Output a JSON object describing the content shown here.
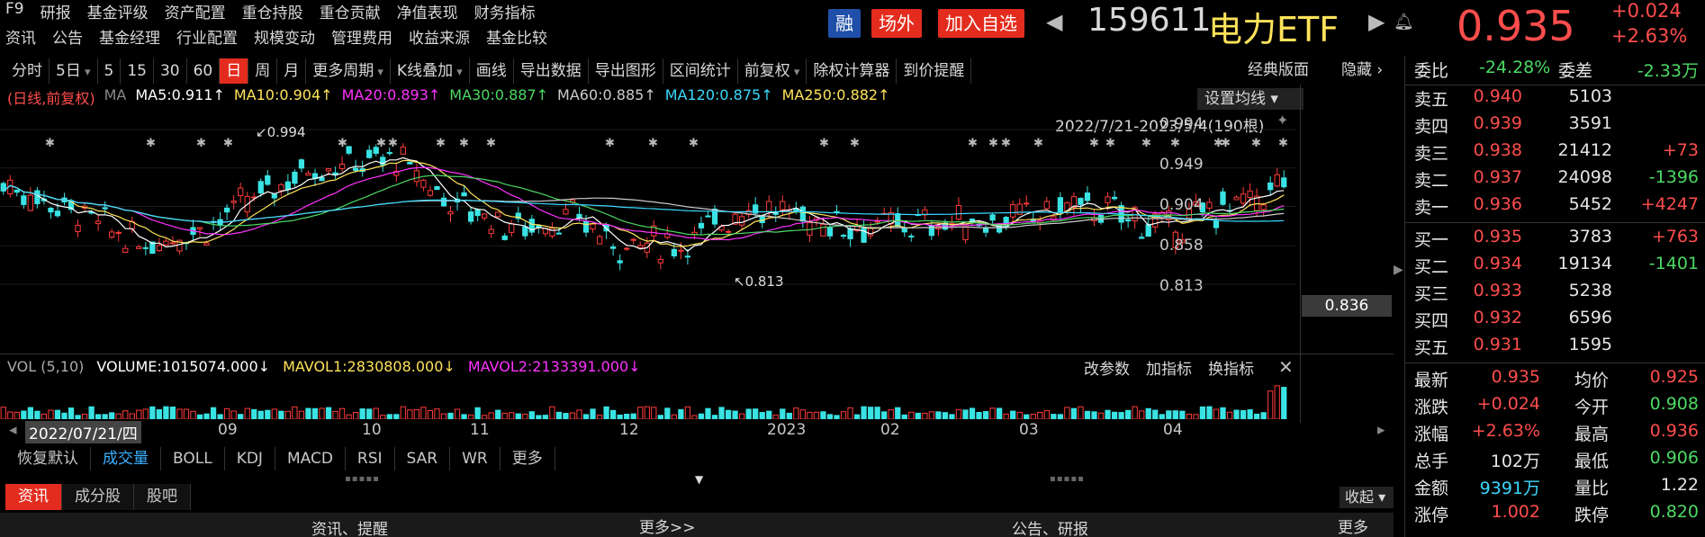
{
  "nav": {
    "row1": [
      "F9",
      "研报",
      "基金评级",
      "资产配置",
      "重仓持股",
      "重仓贡献",
      "净值表现",
      "财务指标"
    ],
    "row2": [
      "资讯",
      "公告",
      "基金经理",
      "行业配置",
      "规模变动",
      "管理费用",
      "收益来源",
      "基金比较"
    ]
  },
  "header": {
    "rong": "融",
    "changwai": "场外",
    "add_fav": "加入自选",
    "code": "159611",
    "name": "电力ETF",
    "price": "0.935",
    "change": "+0.024",
    "change_pct": "+2.63%"
  },
  "toolbar": {
    "items": [
      "分时",
      "5日",
      "5",
      "15",
      "30",
      "60",
      "日",
      "周",
      "月",
      "更多周期",
      "K线叠加",
      "画线",
      "导出数据",
      "导出图形",
      "区间统计",
      "前复权",
      "除权计算器",
      "到价提醒"
    ],
    "active": "日",
    "classic": "经典版面",
    "hide": "隐藏"
  },
  "ma": {
    "mode": "(日线,前复权)",
    "ma_label": "MA",
    "ma5": "MA5:0.911↑",
    "ma10": "MA10:0.904↑",
    "ma20": "MA20:0.893↑",
    "ma30": "MA30:0.887↑",
    "ma60": "MA60:0.885↑",
    "ma120": "MA120:0.875↑",
    "ma250": "MA250:0.882↑",
    "set_ma": "设置均线",
    "range": "2022/7/21-2023/5/4(190根)",
    "high_label": "0.994",
    "low_label": "0.813"
  },
  "colors": {
    "ma5": "#ffffff",
    "ma10": "#ffe35a",
    "ma20": "#ff33ff",
    "ma30": "#4cd964",
    "ma60": "#cccccc",
    "ma120": "#3ad9ff",
    "ma250": "#ffe35a",
    "up": "#ff3b3b",
    "down": "#3ae3e3"
  },
  "yaxis": [
    "0.994",
    "0.949",
    "0.904",
    "0.858",
    "0.813"
  ],
  "price_tag": "0.836",
  "vol": {
    "label": "VOL (5,10)",
    "volume": "VOLUME:1015074.000↓",
    "mavol1": "MAVOL1:2830808.000↓",
    "mavol2": "MAVOL2:2133391.000↓",
    "btns": [
      "改参数",
      "加指标",
      "换指标"
    ]
  },
  "dates": {
    "cursor": "2022/07/21/四",
    "ticks": [
      "09",
      "10",
      "11",
      "12",
      "2023",
      "02",
      "03",
      "04"
    ]
  },
  "ind_tabs": [
    "恢复默认",
    "成交量",
    "BOLL",
    "KDJ",
    "MACD",
    "RSI",
    "SAR",
    "WR",
    "更多"
  ],
  "ind_active": "成交量",
  "bottom_tabs": [
    "资讯",
    "成分股",
    "股吧"
  ],
  "bottom_active": "资讯",
  "collapse": "收起",
  "news": {
    "left": "资讯、提醒",
    "left_more": "更多>>",
    "right": "公告、研报",
    "right_more": "更多>>"
  },
  "panel": {
    "weibi_label": "委比",
    "weibi": "-24.28%",
    "weicha_label": "委差",
    "weicha": "-2.33万",
    "asks": [
      {
        "label": "卖五",
        "price": "0.940",
        "vol": "5103",
        "chg": ""
      },
      {
        "label": "卖四",
        "price": "0.939",
        "vol": "3591",
        "chg": ""
      },
      {
        "label": "卖三",
        "price": "0.938",
        "vol": "21412",
        "chg": "+73"
      },
      {
        "label": "卖二",
        "price": "0.937",
        "vol": "24098",
        "chg": "-1396"
      },
      {
        "label": "卖一",
        "price": "0.936",
        "vol": "5452",
        "chg": "+4247"
      }
    ],
    "bids": [
      {
        "label": "买一",
        "price": "0.935",
        "vol": "3783",
        "chg": "+763"
      },
      {
        "label": "买二",
        "price": "0.934",
        "vol": "19134",
        "chg": "-1401"
      },
      {
        "label": "买三",
        "price": "0.933",
        "vol": "5238",
        "chg": ""
      },
      {
        "label": "买四",
        "price": "0.932",
        "vol": "6596",
        "chg": ""
      },
      {
        "label": "买五",
        "price": "0.931",
        "vol": "1595",
        "chg": ""
      }
    ],
    "stats": [
      {
        "l1": "最新",
        "v1": "0.935",
        "l2": "均价",
        "v2": "0.925"
      },
      {
        "l1": "涨跌",
        "v1": "+0.024",
        "l2": "今开",
        "v2": "0.908"
      },
      {
        "l1": "涨幅",
        "v1": "+2.63%",
        "l2": "最高",
        "v2": "0.936"
      },
      {
        "l1": "总手",
        "v1": "102万",
        "l2": "最低",
        "v2": "0.906"
      },
      {
        "l1": "金额",
        "v1": "9391万",
        "l2": "量比",
        "v2": "1.22"
      },
      {
        "l1": "涨停",
        "v1": "1.002",
        "l2": "跌停",
        "v2": "0.820"
      }
    ]
  }
}
